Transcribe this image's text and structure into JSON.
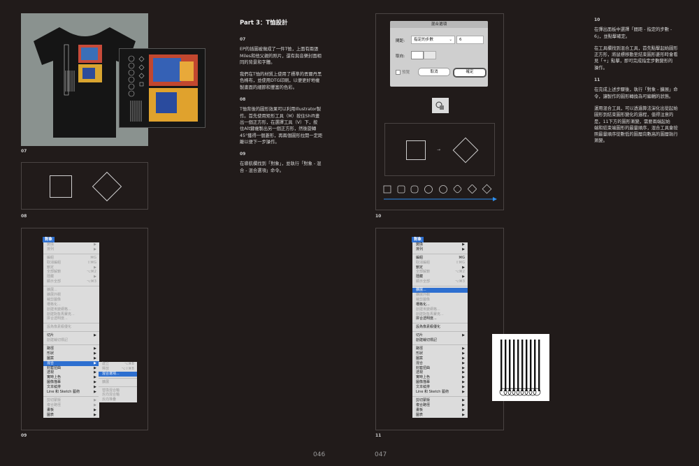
{
  "left_page": {
    "page_number": "046",
    "figure_labels": {
      "f07": "07",
      "f08": "08",
      "f09": "09"
    },
    "section_title": "Part 3：T恤設計",
    "paragraphs": [
      {
        "num": "07",
        "text": "EP的插圖被做成了一件T恤，上面有兩張\nMiles和他父親的照片，還有與音樂封面相\n同的背景和字體。"
      },
      {
        "num": "",
        "text": "我們在T恤的材質上使用了標準的丟爾丹黑\n色棉布，並使用DTG印刷，以便更好地複\n製畫面的細節和豐富的色彩。"
      },
      {
        "num": "08",
        "text": "T恤背後的圖形效果可以利用Illustrator製\n作。首先使用矩形工具（M）按住Shift畫\n出一個正方形，在選擇工具（V）下，按\n住Alt鍵複製出另一個正方形，然後旋轉\n45°獲得一個菱形，再兩個圖形拉開一定距\n離以便下一步操作。"
      },
      {
        "num": "09",
        "text": "在導航欄找到「對象」，並執行「對象 - 混\n合 - 混合選項」命令。"
      }
    ],
    "menu": {
      "header": "對象",
      "items": [
        {
          "label": "變換",
          "sc": "▶",
          "dis": true
        },
        {
          "label": "排列",
          "sc": "▶",
          "dis": true
        },
        {
          "sep": true
        },
        {
          "label": "編組",
          "sc": "⌘G",
          "dis": true
        },
        {
          "label": "取消編組",
          "sc": "⇧⌘G",
          "dis": true
        },
        {
          "label": "鎖定",
          "sc": "▶",
          "dis": true
        },
        {
          "label": "全部解鎖",
          "sc": "⌥⌘2",
          "dis": true
        },
        {
          "label": "隱藏",
          "sc": "▶",
          "dis": true
        },
        {
          "label": "顯示全部",
          "sc": "⌥⌘3",
          "dis": true
        },
        {
          "sep": true
        },
        {
          "label": "擴展...",
          "sc": "",
          "dis": true
        },
        {
          "label": "擴展外觀",
          "sc": "",
          "dis": true
        },
        {
          "label": "裁剪圖像",
          "sc": "",
          "dis": true
        },
        {
          "label": "柵格化...",
          "sc": "",
          "dis": true
        },
        {
          "label": "創建漸變網格...",
          "sc": "",
          "dis": true
        },
        {
          "label": "創建對象馬賽克...",
          "sc": "",
          "dis": true
        },
        {
          "label": "拼合透明度...",
          "sc": "",
          "dis": true
        },
        {
          "sep": true
        },
        {
          "label": "設為像素級優化",
          "sc": "",
          "dis": true
        },
        {
          "sep": true
        },
        {
          "label": "切片",
          "sc": "▶",
          "dis": false
        },
        {
          "label": "創建裁切標記",
          "sc": "",
          "dis": true
        },
        {
          "sep": true
        },
        {
          "label": "路徑",
          "sc": "▶",
          "dis": false
        },
        {
          "label": "形狀",
          "sc": "▶",
          "dis": false
        },
        {
          "label": "圖案",
          "sc": "▶",
          "dis": false
        },
        {
          "label": "混合",
          "sc": "▶",
          "hl": true
        },
        {
          "label": "封套扭曲",
          "sc": "▶",
          "dis": false
        },
        {
          "label": "透視",
          "sc": "▶",
          "dis": false
        },
        {
          "label": "實時上色",
          "sc": "▶",
          "dis": false
        },
        {
          "label": "圖像描摹",
          "sc": "▶",
          "dis": false
        },
        {
          "label": "文本繞排",
          "sc": "▶",
          "dis": false
        },
        {
          "label": "Line 和 Sketch 藝術",
          "sc": "▶",
          "dis": false
        },
        {
          "sep": true
        },
        {
          "label": "剪切蒙版",
          "sc": "▶",
          "dis": true
        },
        {
          "label": "複合路徑",
          "sc": "▶",
          "dis": true
        },
        {
          "label": "畫板",
          "sc": "▶",
          "dis": false
        },
        {
          "label": "圖表",
          "sc": "▶",
          "dis": false
        }
      ],
      "submenu": [
        {
          "label": "建立",
          "sc": "⌥⌘B",
          "dis": true
        },
        {
          "label": "釋放",
          "sc": "⌥⇧⌘B",
          "dis": true
        },
        {
          "label": "混合選項...",
          "sc": "",
          "hl": true
        },
        {
          "sep": true
        },
        {
          "label": "擴展",
          "sc": "",
          "dis": true
        },
        {
          "sep": true
        },
        {
          "label": "替換混合軸",
          "sc": "",
          "dis": true
        },
        {
          "label": "反向混合軸",
          "sc": "",
          "dis": true
        },
        {
          "label": "反向堆疊",
          "sc": "",
          "dis": true
        }
      ]
    }
  },
  "right_page": {
    "page_number": "047",
    "figure_labels": {
      "f10": "10",
      "f11": "11"
    },
    "dialog": {
      "title": "混合選項",
      "spacing_label": "間距:",
      "spacing_value": "指定的步數",
      "steps_value": "6",
      "orientation_label": "取向:",
      "preview_label": "預覽",
      "cancel_label": "取消",
      "ok_label": "確定"
    },
    "paragraphs": [
      {
        "num": "10",
        "text": "在彈出面板中選擇「間距 - 指定的步數 -\n6」，並點擊確定。"
      },
      {
        "num": "",
        "text": "在工具欄找到混合工具，首先點擊起始圖形\n正方形，將鼠標移動至結束圖形菱形時會看\n見「+」點擊，即可完成指定步數變形的\n操作。"
      },
      {
        "num": "11",
        "text": "在完成上述步驟後，執行「對象 - 擴展」命\n令，讓製作的圖形轉換為可編輯的狀態。"
      },
      {
        "num": "",
        "text": "運用混合工具，可以透過算法演化出從起始\n圖形到結束圖形變化的過程，值得注意的\n是，11下方的圖形漸變，需要兩端起始\n端和結束端圖形的最量順序，混合工具會按\n照最量順序從數低的圖層向數高的圖層執行\n漸變。"
      }
    ],
    "menu2": {
      "header": "對象",
      "items": [
        {
          "label": "變換",
          "sc": "▶"
        },
        {
          "label": "排列",
          "sc": "▶"
        },
        {
          "sep": true
        },
        {
          "label": "編組",
          "sc": "⌘G"
        },
        {
          "label": "取消編組",
          "sc": "⇧⌘G",
          "dis": true
        },
        {
          "label": "鎖定",
          "sc": "▶"
        },
        {
          "label": "全部解鎖",
          "sc": "⌥⌘2",
          "dis": true
        },
        {
          "label": "隱藏",
          "sc": "▶"
        },
        {
          "label": "顯示全部",
          "sc": "⌥⌘3",
          "dis": true
        },
        {
          "sep": true
        },
        {
          "label": "擴展...",
          "sc": "",
          "hl": true
        },
        {
          "label": "擴展外觀",
          "sc": "",
          "dis": true
        },
        {
          "label": "裁剪圖像",
          "sc": "",
          "dis": true
        },
        {
          "label": "柵格化...",
          "sc": ""
        },
        {
          "label": "創建漸變網格...",
          "sc": "",
          "dis": true
        },
        {
          "label": "創建對象馬賽克...",
          "sc": "",
          "dis": true
        },
        {
          "label": "拼合透明度...",
          "sc": ""
        },
        {
          "sep": true
        },
        {
          "label": "設為像素級優化",
          "sc": ""
        },
        {
          "sep": true
        },
        {
          "label": "切片",
          "sc": "▶"
        },
        {
          "label": "創建裁切標記",
          "sc": ""
        },
        {
          "sep": true
        },
        {
          "label": "路徑",
          "sc": "▶"
        },
        {
          "label": "形狀",
          "sc": "▶"
        },
        {
          "label": "圖案",
          "sc": "▶"
        },
        {
          "label": "混合",
          "sc": "▶"
        },
        {
          "label": "封套扭曲",
          "sc": "▶"
        },
        {
          "label": "透視",
          "sc": "▶"
        },
        {
          "label": "實時上色",
          "sc": "▶"
        },
        {
          "label": "圖像描摹",
          "sc": "▶"
        },
        {
          "label": "文本繞排",
          "sc": "▶"
        },
        {
          "label": "Line 和 Sketch 藝術",
          "sc": "▶"
        },
        {
          "sep": true
        },
        {
          "label": "剪切蒙版",
          "sc": "▶"
        },
        {
          "label": "複合路徑",
          "sc": "▶"
        },
        {
          "label": "畫板",
          "sc": "▶"
        },
        {
          "label": "圖表",
          "sc": "▶"
        }
      ]
    }
  },
  "colors": {
    "background": "#211b1a",
    "menu_highlight": "#2d6fd0",
    "arrow": "#2d8ff0"
  }
}
